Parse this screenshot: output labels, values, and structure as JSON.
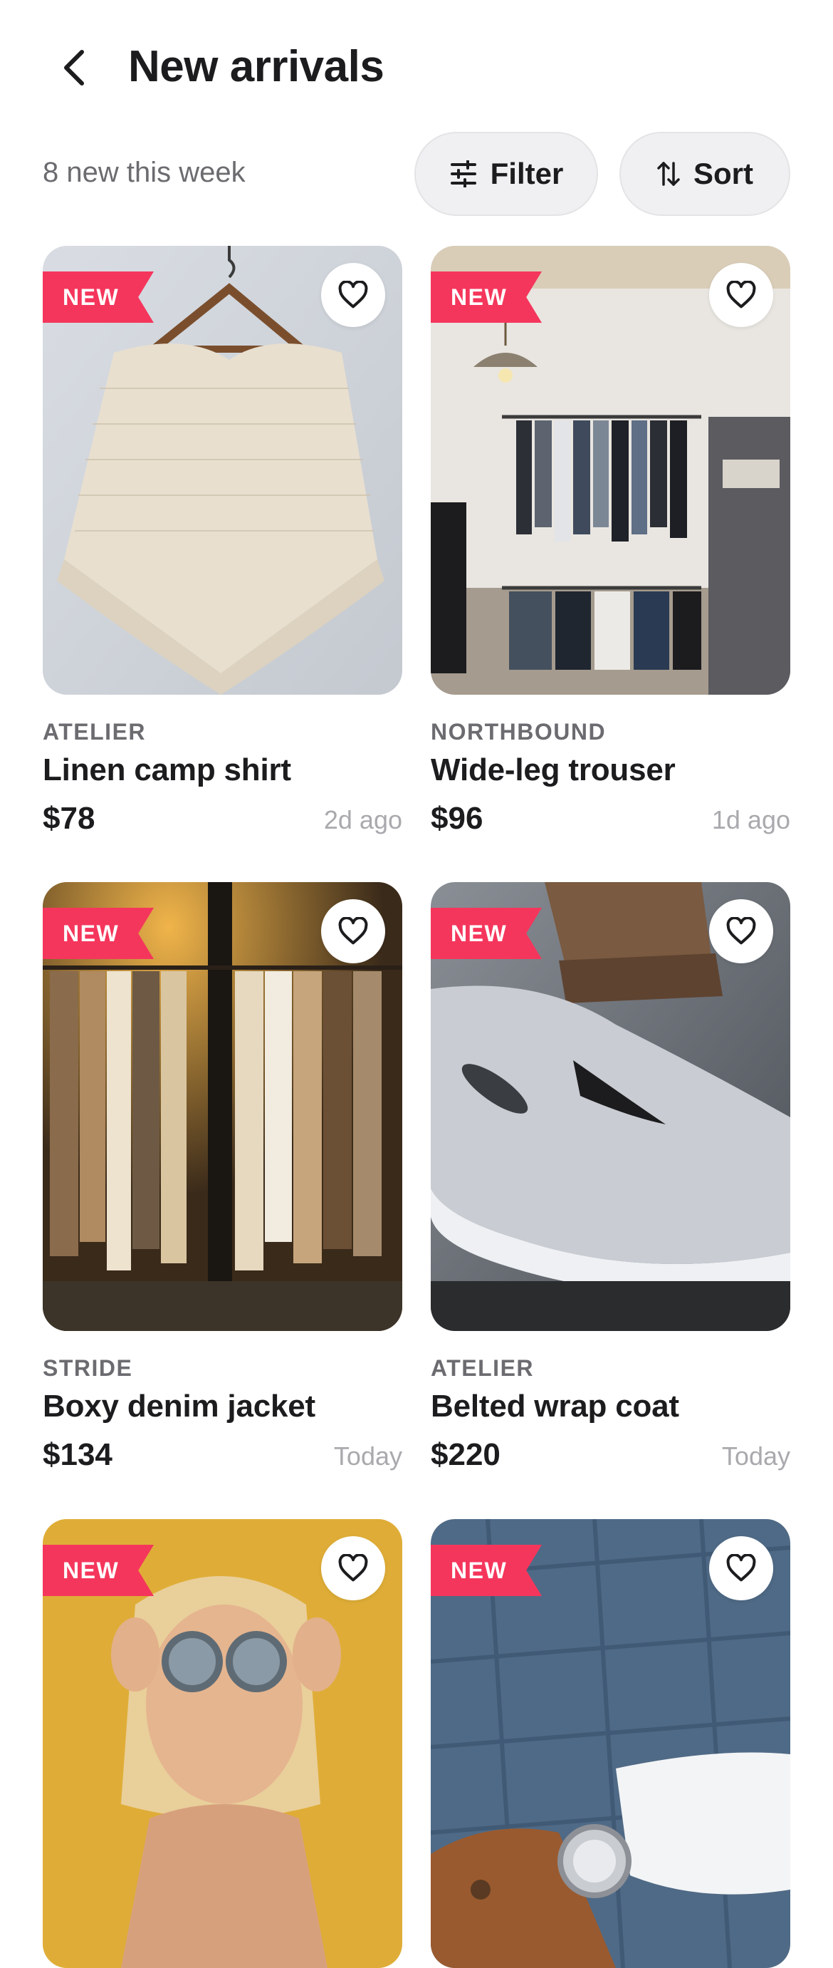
{
  "header": {
    "title": "New arrivals",
    "back_icon": "chevron-left-icon"
  },
  "toolbar": {
    "count_text": "8 new this week",
    "filter_label": "Filter",
    "filter_icon": "sliders-icon",
    "sort_label": "Sort",
    "sort_icon": "sort-arrows-icon"
  },
  "products": [
    {
      "badge": "NEW",
      "brand": "ATELIER",
      "name": "Linen camp shirt",
      "price": "$78",
      "age": "2d ago",
      "image": "cream knit poncho on hanger"
    },
    {
      "badge": "NEW",
      "brand": "NORTHBOUND",
      "name": "Wide-leg trouser",
      "price": "$96",
      "age": "1d ago",
      "image": "clothing store rack interior"
    },
    {
      "badge": "NEW",
      "brand": "STRIDE",
      "name": "Boxy denim jacket",
      "price": "$134",
      "age": "Today",
      "image": "rack of beige knit cardigans"
    },
    {
      "badge": "NEW",
      "brand": "ATELIER",
      "name": "Belted wrap coat",
      "price": "$220",
      "age": "Today",
      "image": "grey sneaker close-up"
    },
    {
      "badge": "NEW",
      "image": "woman with round sunglasses yellow wall"
    },
    {
      "badge": "NEW",
      "image": "plaid suit sleeve with wristwatch"
    }
  ],
  "colors": {
    "badge": "#f5365c",
    "chip_bg": "#f0f0f2",
    "text_primary": "#1c1c1e",
    "text_secondary": "#6b6b70",
    "text_muted": "#a9a9ae"
  }
}
